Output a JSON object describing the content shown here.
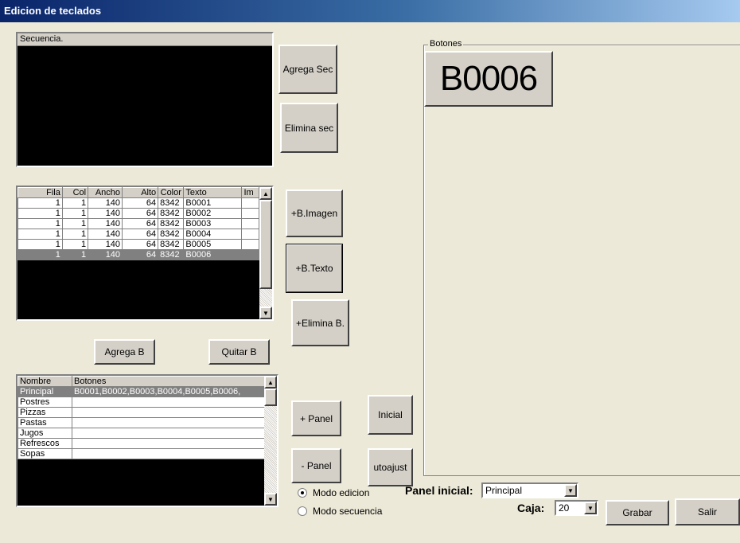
{
  "window": {
    "title": "Edicion de teclados"
  },
  "secuencia": {
    "header": "Secuencia."
  },
  "buttons": {
    "agrega_sec": "Agrega Sec",
    "elimina_sec": "Elimina sec",
    "b_imagen": "+B.Imagen",
    "b_texto": "+B.Texto",
    "elimina_b": "+Elimina B.",
    "agrega_b": "Agrega B",
    "quitar_b": "Quitar B",
    "panel_add": "+ Panel",
    "panel_remove": "- Panel",
    "inicial": "Inicial",
    "autoajust": "utoajust",
    "grabar": "Grabar",
    "salir": "Salir"
  },
  "buttons_grid": {
    "headers": [
      "Fila",
      "Col",
      "Ancho",
      "Alto",
      "Color",
      "Texto",
      "Im"
    ],
    "rows": [
      [
        "1",
        "1",
        "140",
        "64",
        "8342",
        "B0001",
        ""
      ],
      [
        "1",
        "1",
        "140",
        "64",
        "8342",
        "B0002",
        ""
      ],
      [
        "1",
        "1",
        "140",
        "64",
        "8342",
        "B0003",
        ""
      ],
      [
        "1",
        "1",
        "140",
        "64",
        "8342",
        "B0004",
        ""
      ],
      [
        "1",
        "1",
        "140",
        "64",
        "8342",
        "B0005",
        ""
      ],
      [
        "1",
        "1",
        "140",
        "64",
        "8342",
        "B0006",
        ""
      ]
    ],
    "selected_row": 5
  },
  "panels_grid": {
    "headers": [
      "Nombre",
      "Botones"
    ],
    "rows": [
      [
        "Principal",
        "B0001,B0002,B0003,B0004,B0005,B0006,"
      ],
      [
        "Postres",
        ""
      ],
      [
        "Pizzas",
        ""
      ],
      [
        "Pastas",
        ""
      ],
      [
        "Jugos",
        ""
      ],
      [
        "Refrescos",
        ""
      ],
      [
        "Sopas",
        ""
      ]
    ],
    "selected_row": 0
  },
  "botones_panel": {
    "legend": "Botones",
    "preview_button": "B0006"
  },
  "mode": {
    "edicion": "Modo edicion",
    "secuencia": "Modo secuencia",
    "selected": "edicion"
  },
  "panel_inicial": {
    "label": "Panel inicial:",
    "value": "Principal"
  },
  "caja": {
    "label": "Caja:",
    "value": "20"
  },
  "icons": {
    "scroll_up": "▲",
    "scroll_down": "▼",
    "dropdown": "▼"
  }
}
